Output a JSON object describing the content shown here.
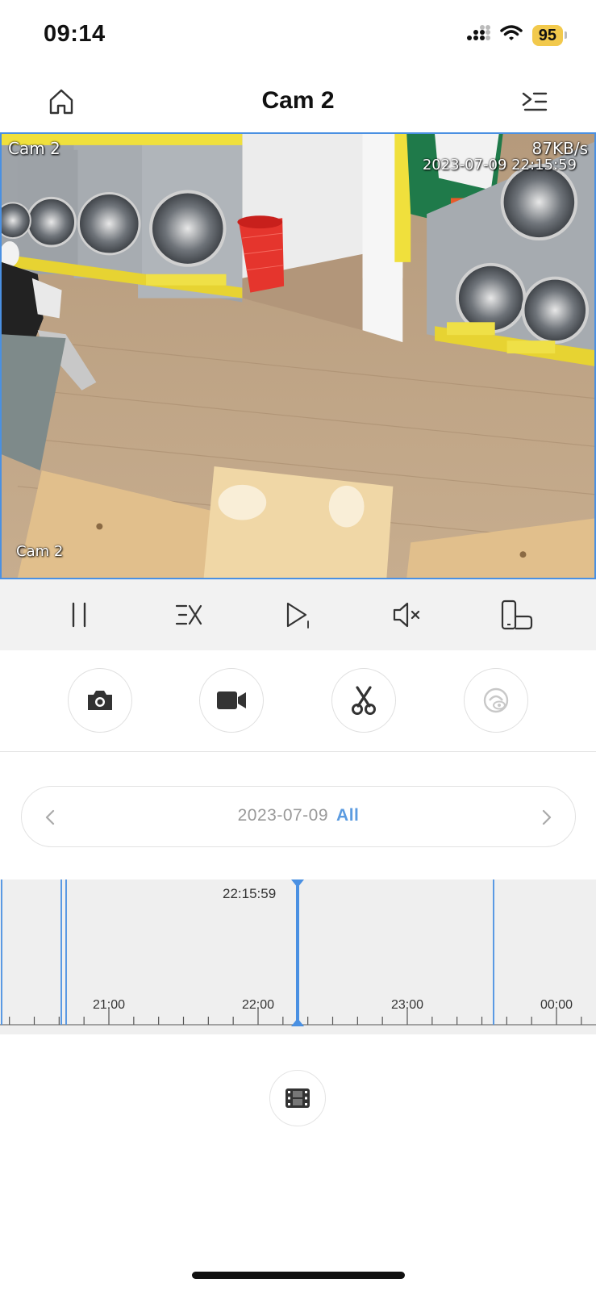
{
  "status_bar": {
    "time": "09:14",
    "battery": "95"
  },
  "header": {
    "title": "Cam 2"
  },
  "video": {
    "osd_top_left": "Cam 2",
    "osd_bitrate": "87KB/s",
    "osd_timestamp": "2023-07-09 22:15:59",
    "osd_bottom_left": "Cam 2"
  },
  "controls": [
    "pause-icon",
    "speed-icon",
    "next-frame-icon",
    "mute-icon",
    "rotate-screen-icon"
  ],
  "actions": [
    "camera-icon",
    "video-record-icon",
    "scissors-icon",
    "eye-privacy-icon"
  ],
  "date_selector": {
    "date": "2023-07-09",
    "filter": "All"
  },
  "timeline": {
    "current_time": "22:15:59",
    "hour_labels": [
      "21:00",
      "22:00",
      "23:00",
      "00:00"
    ],
    "accent": "#4a90e2"
  }
}
